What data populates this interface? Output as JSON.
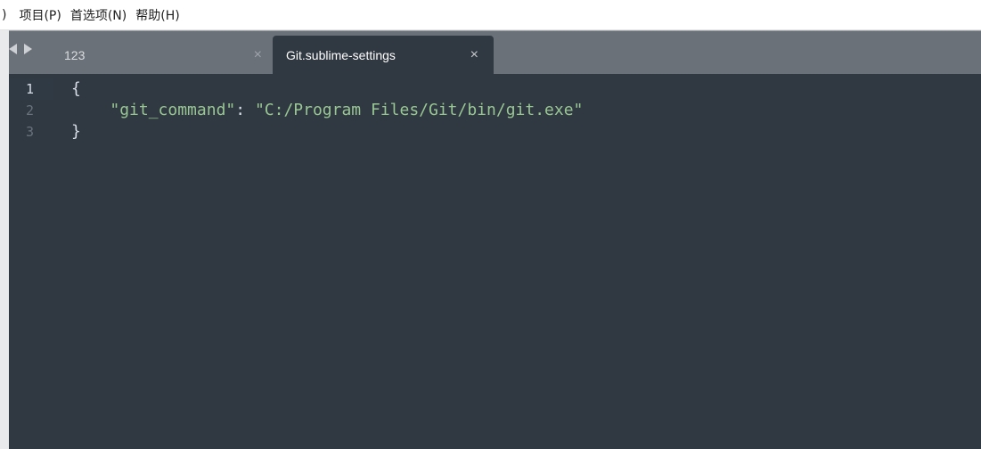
{
  "menubar": {
    "items": [
      {
        "label": ")"
      },
      {
        "label": "项目(P)"
      },
      {
        "label": "首选项(N)"
      },
      {
        "label": "帮助(H)"
      }
    ]
  },
  "tabs": [
    {
      "label": "123",
      "active": false
    },
    {
      "label": "Git.sublime-settings",
      "active": true
    }
  ],
  "tab_close_glyph": "×",
  "editor": {
    "line_numbers": [
      "1",
      "2",
      "3"
    ],
    "current_line": 1,
    "lines": {
      "open_brace": "{",
      "indent": "    ",
      "key": "\"git_command\"",
      "colon": ": ",
      "value": "\"C:/Program Files/Git/bin/git.exe\"",
      "close_brace": "}"
    },
    "colors": {
      "background": "#303841",
      "string": "#99c794",
      "text": "#d8dee9",
      "gutter": "#68737d",
      "tabbar": "#6b7178"
    }
  }
}
